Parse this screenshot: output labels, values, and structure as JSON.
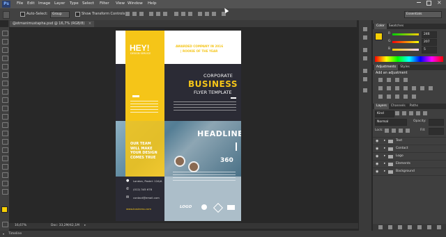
{
  "app": {
    "logo": "Ps"
  },
  "menu": [
    "File",
    "Edit",
    "Image",
    "Layer",
    "Type",
    "Select",
    "Filter",
    "View",
    "Window",
    "Help"
  ],
  "options": {
    "auto_select_label": "Auto-Select:",
    "auto_select_value": "Group",
    "transform_label": "Show Transform Controls",
    "workspace": "Essentials"
  },
  "document": {
    "tab_title": "@otmanimustapha.psd @ 16,7% (RGB/8)",
    "zoom": "16,67%",
    "doc_size": "Doc: 33,2M/42,1M"
  },
  "timeline_label": "Timeline",
  "color_panel": {
    "tabs": [
      "Color",
      "Swatches"
    ],
    "r_label": "R",
    "g_label": "G",
    "b_label": "B",
    "r": "246",
    "g": "207",
    "b": "5",
    "fg": "#f6cf05"
  },
  "adjustments": {
    "tabs": [
      "Adjustments",
      "Styles"
    ],
    "add_label": "Add an adjustment"
  },
  "layers_panel": {
    "tabs": [
      "Layers",
      "Channels",
      "Paths"
    ],
    "kind_label": "Kind",
    "blend_mode": "Normal",
    "opacity_label": "Opacity:",
    "lock_label": "Lock:",
    "fill_label": "Fill:",
    "layers": [
      "Text",
      "Contact",
      "Logo",
      "Elements",
      "Background"
    ]
  },
  "flyer": {
    "hey": "HEY!",
    "hey_sub": "DESIGN SERVICE",
    "awarded_line1": "AWARDED COMPANY IN 2016",
    "awarded_line2": "| ROOKIE OF THE YEAR",
    "corporate": "CORPORATE",
    "business": "BUSINESS",
    "flyer_template": "FLYER TEMPLATE",
    "team_line1": "OUR TEAM",
    "team_line2": "WILL MAKE",
    "team_line3": "YOUR DESIGN",
    "team_line4": "COMES TRUE",
    "headline": "HEADLINE",
    "headline_num": "360",
    "contact_address": "London, Postel: 12A/A",
    "contact_phone": "(012) 345 678",
    "contact_email": "contact@email.com",
    "website": "www.business.com",
    "logo_text": "LOGO",
    "accent": "#f5c518",
    "dark": "#2b2b35"
  }
}
